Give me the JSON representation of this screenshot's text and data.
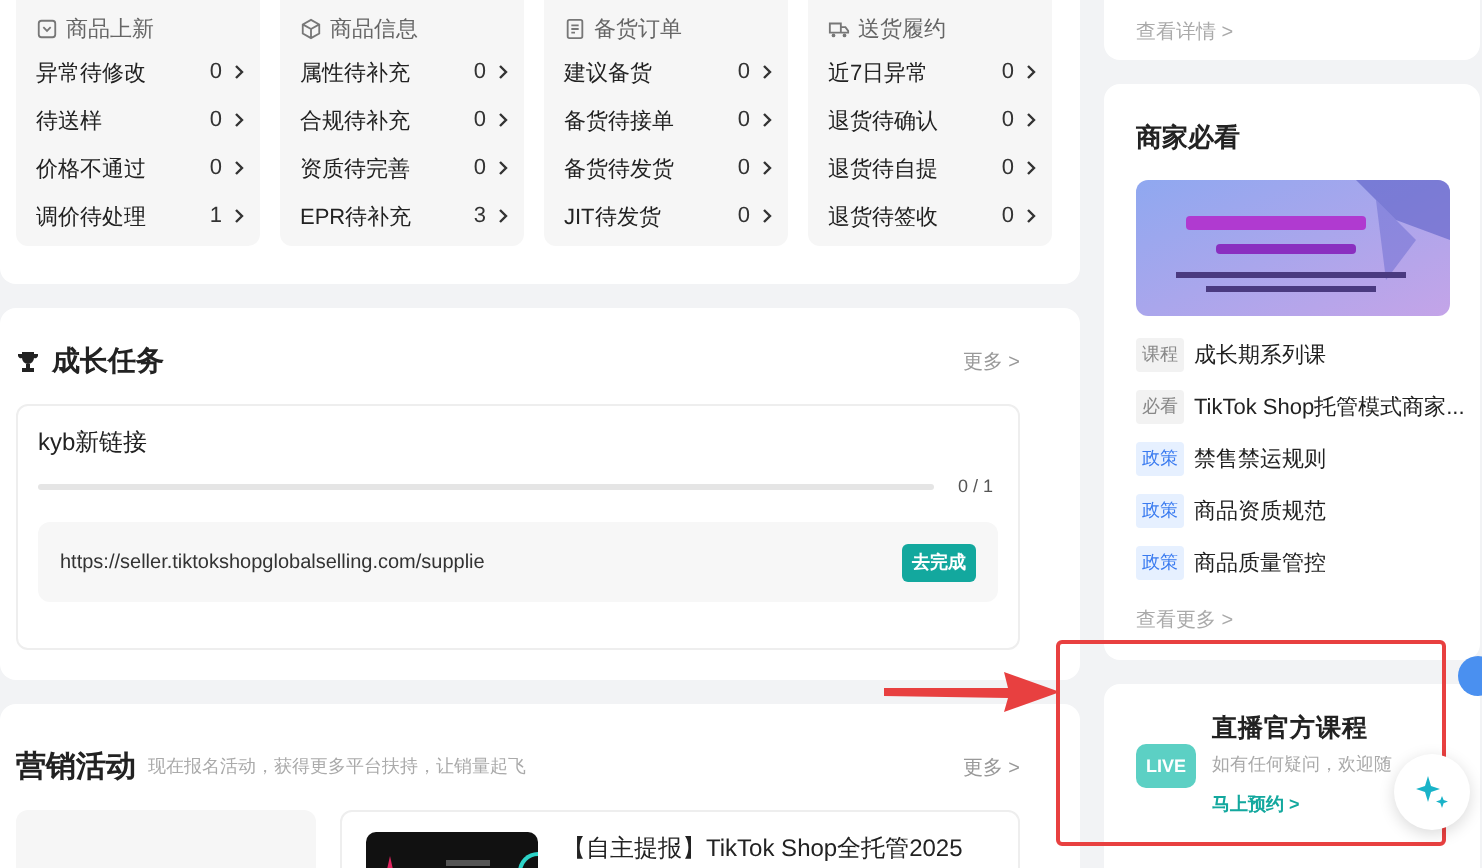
{
  "todo_groups": [
    {
      "title": "商品上新",
      "items": [
        {
          "label": "异常待修改",
          "count": "0"
        },
        {
          "label": "待送样",
          "count": "0"
        },
        {
          "label": "价格不通过",
          "count": "0"
        },
        {
          "label": "调价待处理",
          "count": "1"
        }
      ]
    },
    {
      "title": "商品信息",
      "items": [
        {
          "label": "属性待补充",
          "count": "0"
        },
        {
          "label": "合规待补充",
          "count": "0"
        },
        {
          "label": "资质待完善",
          "count": "0"
        },
        {
          "label": "EPR待补充",
          "count": "3"
        }
      ]
    },
    {
      "title": "备货订单",
      "items": [
        {
          "label": "建议备货",
          "count": "0"
        },
        {
          "label": "备货待接单",
          "count": "0"
        },
        {
          "label": "备货待发货",
          "count": "0"
        },
        {
          "label": "JIT待发货",
          "count": "0"
        }
      ]
    },
    {
      "title": "送货履约",
      "items": [
        {
          "label": "近7日异常",
          "count": "0"
        },
        {
          "label": "退货待确认",
          "count": "0"
        },
        {
          "label": "退货待自提",
          "count": "0"
        },
        {
          "label": "退货待签收",
          "count": "0"
        }
      ]
    }
  ],
  "growth_tasks": {
    "title": "成长任务",
    "more": "更多 >",
    "task": {
      "name": "kyb新链接",
      "level": 0,
      "progress": "0 / 1",
      "link": "https://seller.tiktokshopglobalselling.com/supplie",
      "action": "去完成"
    }
  },
  "marketing": {
    "title": "营销活动",
    "subtitle": "现在报名活动，获得更多平台扶持，让销量起飞",
    "more": "更多 >",
    "campaign": {
      "title": "【自主提报】TikTok Shop全托管2025"
    }
  },
  "sidebar": {
    "top_link": "查看详情 >",
    "must_read": {
      "title": "商家必看",
      "items": [
        {
          "tag": "课程",
          "kind": "grey",
          "text": "成长期系列课"
        },
        {
          "tag": "必看",
          "kind": "grey",
          "text": "TikTok Shop托管模式商家..."
        },
        {
          "tag": "政策",
          "kind": "blue",
          "text": "禁售禁运规则"
        },
        {
          "tag": "政策",
          "kind": "blue",
          "text": "商品资质规范"
        },
        {
          "tag": "政策",
          "kind": "blue",
          "text": "商品质量管控"
        }
      ],
      "more": "查看更多 >"
    },
    "live": {
      "badge": "LIVE",
      "title": "直播官方课程",
      "desc": "如有任何疑问，欢迎随",
      "link": "马上预约 >"
    }
  }
}
